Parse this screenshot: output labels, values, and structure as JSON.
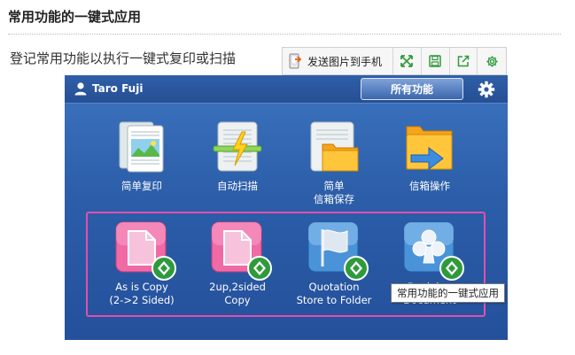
{
  "article": {
    "heading": "常用功能的一键式应用",
    "paragraph": "登记常用功能以执行一键式复印或扫描"
  },
  "image_toolbar": {
    "send_label": "发送图片到手机",
    "buttons": [
      "expand-icon",
      "save-icon",
      "share-icon",
      "settings-icon"
    ]
  },
  "panel": {
    "user_name": "Taro Fuji",
    "all_functions_label": "所有功能",
    "row1": [
      {
        "label": "简单复印",
        "icon": "copy-icon"
      },
      {
        "label": "自动扫描",
        "icon": "scan-icon"
      },
      {
        "label": "简单\n信箱保存",
        "icon": "folder-icon"
      },
      {
        "label": "信箱操作",
        "icon": "mailbox-icon"
      }
    ],
    "row2": [
      {
        "label": "As is Copy\n(2->2 Sided)",
        "icon": "one-touch-copy-icon"
      },
      {
        "label": "2up,2sided\nCopy",
        "icon": "one-touch-copy-icon"
      },
      {
        "label": "Quotation\nStore to Folder",
        "icon": "flag-icon"
      },
      {
        "label": "Desiging Document",
        "icon": "club-icon"
      }
    ]
  },
  "tooltip": "常用功能的一键式应用",
  "colors": {
    "panel_blue": "#2c5ea9",
    "highlight_pink": "#e24fae",
    "badge_green": "#2f9a3c",
    "toolbar_green": "#2e9a3a"
  }
}
